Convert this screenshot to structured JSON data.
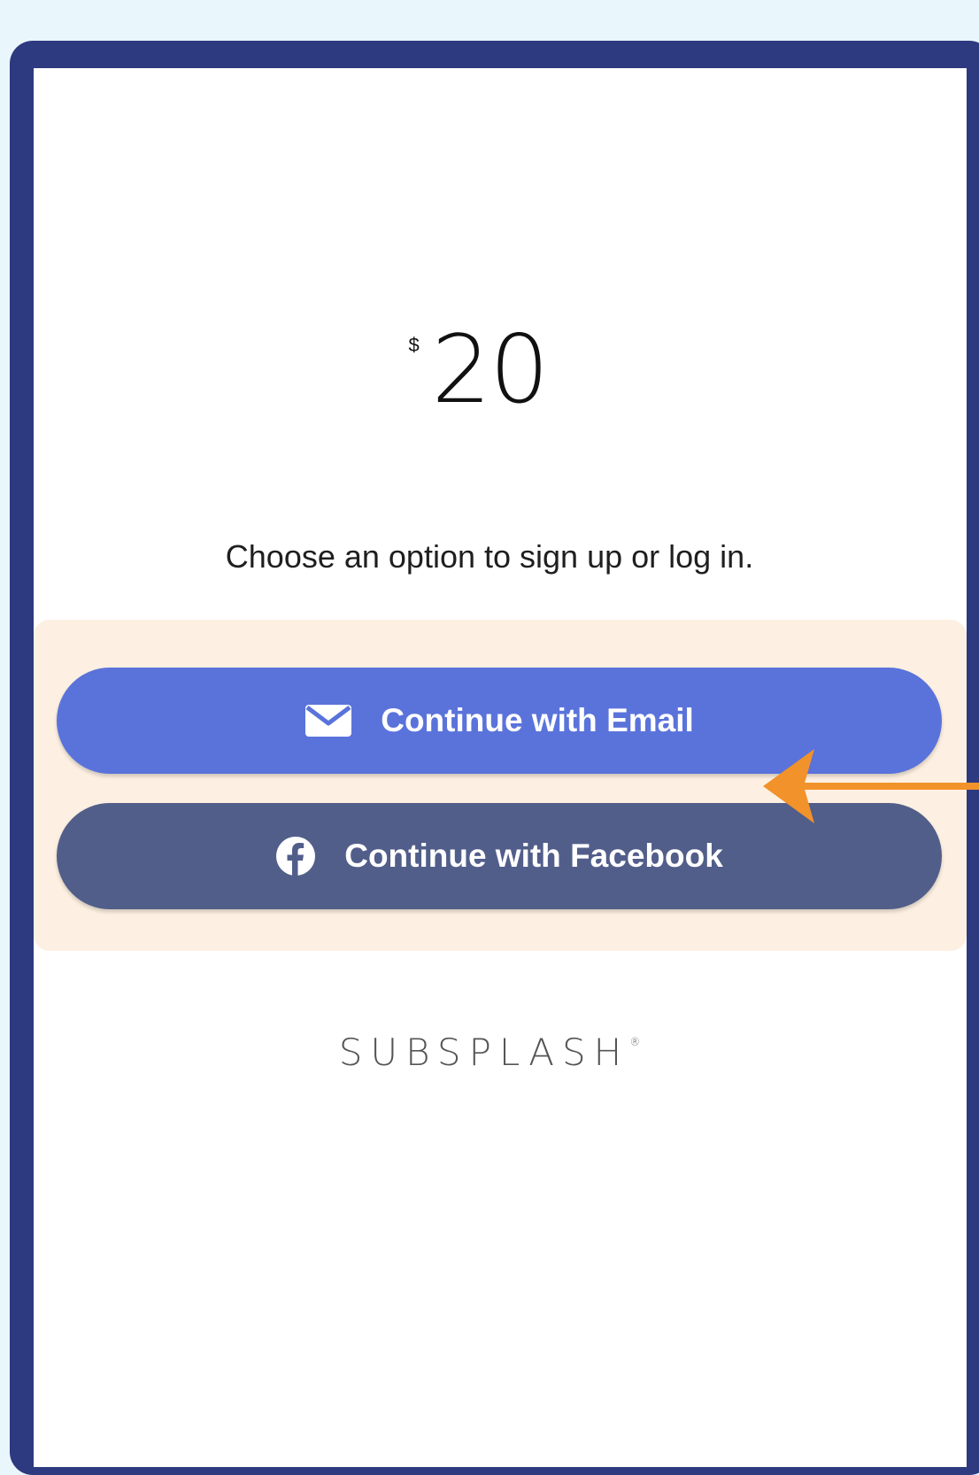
{
  "donation": {
    "currency_symbol": "$",
    "amount": "20"
  },
  "prompt_text": "Choose an option to sign up or log in.",
  "buttons": {
    "email_label": "Continue with Email",
    "facebook_label": "Continue with Facebook"
  },
  "brand": {
    "logo_text": "SUBSPLASH",
    "registered_mark": "®"
  },
  "colors": {
    "page_background": "#e9f6fc",
    "frame": "#2d3a7f",
    "highlight": "#fdf0e2",
    "email_button": "#5a73db",
    "facebook_button": "#525e8a",
    "annotation_arrow": "#f2922a"
  },
  "icons": {
    "email_button_icon": "envelope-icon",
    "facebook_button_icon": "facebook-icon",
    "annotation": "arrow-left-icon"
  }
}
